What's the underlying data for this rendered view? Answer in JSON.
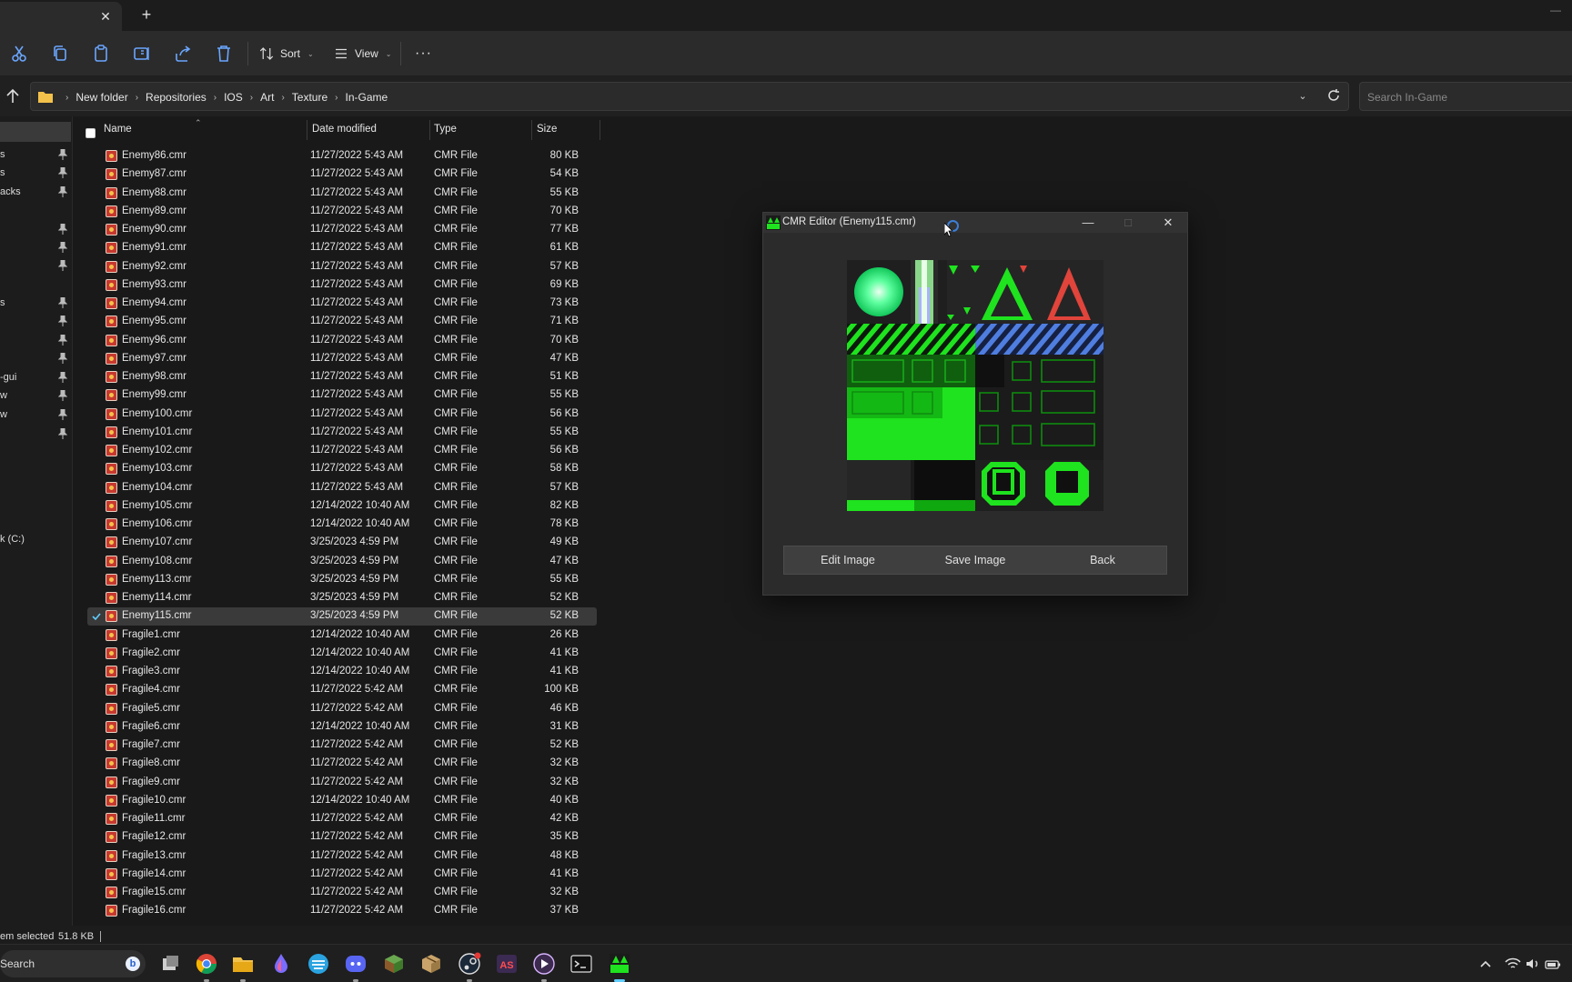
{
  "toolbar": {
    "sort_label": "Sort",
    "view_label": "View",
    "more_label": "···"
  },
  "address": {
    "crumbs": [
      "New folder",
      "Repositories",
      "IOS",
      "Art",
      "Texture",
      "In-Game"
    ],
    "search_placeholder": "Search In-Game"
  },
  "nav": {
    "items": [
      {
        "label": "s"
      },
      {
        "label": "s"
      },
      {
        "label": "acks"
      },
      {
        "label": ""
      },
      {
        "label": ""
      },
      {
        "label": ""
      },
      {
        "label": "s"
      },
      {
        "label": ""
      },
      {
        "label": ""
      },
      {
        "label": ""
      },
      {
        "label": "-gui"
      },
      {
        "label": "w"
      },
      {
        "label": "w"
      },
      {
        "label": ""
      }
    ],
    "drive": "k (C:)"
  },
  "columns": {
    "name": "Name",
    "date": "Date modified",
    "type": "Type",
    "size": "Size"
  },
  "files": [
    {
      "name": "Enemy86.cmr",
      "date": "11/27/2022 5:43 AM",
      "type": "CMR File",
      "size": "80 KB"
    },
    {
      "name": "Enemy87.cmr",
      "date": "11/27/2022 5:43 AM",
      "type": "CMR File",
      "size": "54 KB"
    },
    {
      "name": "Enemy88.cmr",
      "date": "11/27/2022 5:43 AM",
      "type": "CMR File",
      "size": "55 KB"
    },
    {
      "name": "Enemy89.cmr",
      "date": "11/27/2022 5:43 AM",
      "type": "CMR File",
      "size": "70 KB"
    },
    {
      "name": "Enemy90.cmr",
      "date": "11/27/2022 5:43 AM",
      "type": "CMR File",
      "size": "77 KB"
    },
    {
      "name": "Enemy91.cmr",
      "date": "11/27/2022 5:43 AM",
      "type": "CMR File",
      "size": "61 KB"
    },
    {
      "name": "Enemy92.cmr",
      "date": "11/27/2022 5:43 AM",
      "type": "CMR File",
      "size": "57 KB"
    },
    {
      "name": "Enemy93.cmr",
      "date": "11/27/2022 5:43 AM",
      "type": "CMR File",
      "size": "69 KB"
    },
    {
      "name": "Enemy94.cmr",
      "date": "11/27/2022 5:43 AM",
      "type": "CMR File",
      "size": "73 KB"
    },
    {
      "name": "Enemy95.cmr",
      "date": "11/27/2022 5:43 AM",
      "type": "CMR File",
      "size": "71 KB"
    },
    {
      "name": "Enemy96.cmr",
      "date": "11/27/2022 5:43 AM",
      "type": "CMR File",
      "size": "70 KB"
    },
    {
      "name": "Enemy97.cmr",
      "date": "11/27/2022 5:43 AM",
      "type": "CMR File",
      "size": "47 KB"
    },
    {
      "name": "Enemy98.cmr",
      "date": "11/27/2022 5:43 AM",
      "type": "CMR File",
      "size": "51 KB"
    },
    {
      "name": "Enemy99.cmr",
      "date": "11/27/2022 5:43 AM",
      "type": "CMR File",
      "size": "55 KB"
    },
    {
      "name": "Enemy100.cmr",
      "date": "11/27/2022 5:43 AM",
      "type": "CMR File",
      "size": "56 KB"
    },
    {
      "name": "Enemy101.cmr",
      "date": "11/27/2022 5:43 AM",
      "type": "CMR File",
      "size": "55 KB"
    },
    {
      "name": "Enemy102.cmr",
      "date": "11/27/2022 5:43 AM",
      "type": "CMR File",
      "size": "56 KB"
    },
    {
      "name": "Enemy103.cmr",
      "date": "11/27/2022 5:43 AM",
      "type": "CMR File",
      "size": "58 KB"
    },
    {
      "name": "Enemy104.cmr",
      "date": "11/27/2022 5:43 AM",
      "type": "CMR File",
      "size": "57 KB"
    },
    {
      "name": "Enemy105.cmr",
      "date": "12/14/2022 10:40 AM",
      "type": "CMR File",
      "size": "82 KB"
    },
    {
      "name": "Enemy106.cmr",
      "date": "12/14/2022 10:40 AM",
      "type": "CMR File",
      "size": "78 KB"
    },
    {
      "name": "Enemy107.cmr",
      "date": "3/25/2023 4:59 PM",
      "type": "CMR File",
      "size": "49 KB"
    },
    {
      "name": "Enemy108.cmr",
      "date": "3/25/2023 4:59 PM",
      "type": "CMR File",
      "size": "47 KB"
    },
    {
      "name": "Enemy113.cmr",
      "date": "3/25/2023 4:59 PM",
      "type": "CMR File",
      "size": "55 KB"
    },
    {
      "name": "Enemy114.cmr",
      "date": "3/25/2023 4:59 PM",
      "type": "CMR File",
      "size": "52 KB"
    },
    {
      "name": "Enemy115.cmr",
      "date": "3/25/2023 4:59 PM",
      "type": "CMR File",
      "size": "52 KB",
      "selected": true
    },
    {
      "name": "Fragile1.cmr",
      "date": "12/14/2022 10:40 AM",
      "type": "CMR File",
      "size": "26 KB"
    },
    {
      "name": "Fragile2.cmr",
      "date": "12/14/2022 10:40 AM",
      "type": "CMR File",
      "size": "41 KB"
    },
    {
      "name": "Fragile3.cmr",
      "date": "12/14/2022 10:40 AM",
      "type": "CMR File",
      "size": "41 KB"
    },
    {
      "name": "Fragile4.cmr",
      "date": "11/27/2022 5:42 AM",
      "type": "CMR File",
      "size": "100 KB"
    },
    {
      "name": "Fragile5.cmr",
      "date": "11/27/2022 5:42 AM",
      "type": "CMR File",
      "size": "46 KB"
    },
    {
      "name": "Fragile6.cmr",
      "date": "12/14/2022 10:40 AM",
      "type": "CMR File",
      "size": "31 KB"
    },
    {
      "name": "Fragile7.cmr",
      "date": "11/27/2022 5:42 AM",
      "type": "CMR File",
      "size": "52 KB"
    },
    {
      "name": "Fragile8.cmr",
      "date": "11/27/2022 5:42 AM",
      "type": "CMR File",
      "size": "32 KB"
    },
    {
      "name": "Fragile9.cmr",
      "date": "11/27/2022 5:42 AM",
      "type": "CMR File",
      "size": "32 KB"
    },
    {
      "name": "Fragile10.cmr",
      "date": "12/14/2022 10:40 AM",
      "type": "CMR File",
      "size": "40 KB"
    },
    {
      "name": "Fragile11.cmr",
      "date": "11/27/2022 5:42 AM",
      "type": "CMR File",
      "size": "42 KB"
    },
    {
      "name": "Fragile12.cmr",
      "date": "11/27/2022 5:42 AM",
      "type": "CMR File",
      "size": "35 KB"
    },
    {
      "name": "Fragile13.cmr",
      "date": "11/27/2022 5:42 AM",
      "type": "CMR File",
      "size": "48 KB"
    },
    {
      "name": "Fragile14.cmr",
      "date": "11/27/2022 5:42 AM",
      "type": "CMR File",
      "size": "41 KB"
    },
    {
      "name": "Fragile15.cmr",
      "date": "11/27/2022 5:42 AM",
      "type": "CMR File",
      "size": "32 KB"
    },
    {
      "name": "Fragile16.cmr",
      "date": "11/27/2022 5:42 AM",
      "type": "CMR File",
      "size": "37 KB"
    }
  ],
  "status": {
    "selection": "em selected",
    "size": "51.8 KB"
  },
  "taskbar": {
    "search_label": "Search",
    "apps": [
      "task-view",
      "chrome",
      "file-explorer",
      "drop-app",
      "app-5",
      "discord",
      "minecraft",
      "package-app",
      "steam",
      "aseprite",
      "media-player",
      "terminal",
      "cmr-editor"
    ]
  },
  "cmr_editor": {
    "title": "CMR Editor (Enemy115.cmr)",
    "edit_label": "Edit Image",
    "save_label": "Save Image",
    "back_label": "Back"
  },
  "colors": {
    "accent": "#60cdff",
    "texture_green": "#1ee31e",
    "texture_blue": "#3f6fdc",
    "texture_red": "#e0443b"
  }
}
